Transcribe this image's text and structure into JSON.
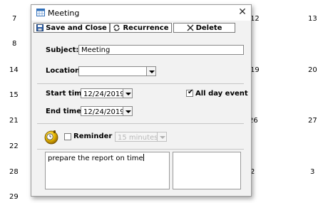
{
  "calendar_days": [
    "7",
    "12",
    "13",
    "8",
    "14",
    "19",
    "20",
    "15",
    "21",
    "26",
    "27",
    "22",
    "28",
    "2",
    "3",
    "29"
  ],
  "dialog": {
    "title": "Meeting",
    "toolbar": {
      "save_label": "Save and Close",
      "recurrence_label": "Recurrence",
      "delete_label": "Delete"
    },
    "subject": {
      "label": "Subject:",
      "value": "Meeting"
    },
    "location": {
      "label": "Location:",
      "value": ""
    },
    "start_time": {
      "label": "Start time:",
      "value": "12/24/2019"
    },
    "end_time": {
      "label": "End time:",
      "value": "12/24/2019"
    },
    "all_day": {
      "label": "All day event",
      "checked": true
    },
    "reminder": {
      "label": "Reminder",
      "checked": false,
      "value": "15 minutes"
    },
    "notes": "prepare the report on time"
  }
}
